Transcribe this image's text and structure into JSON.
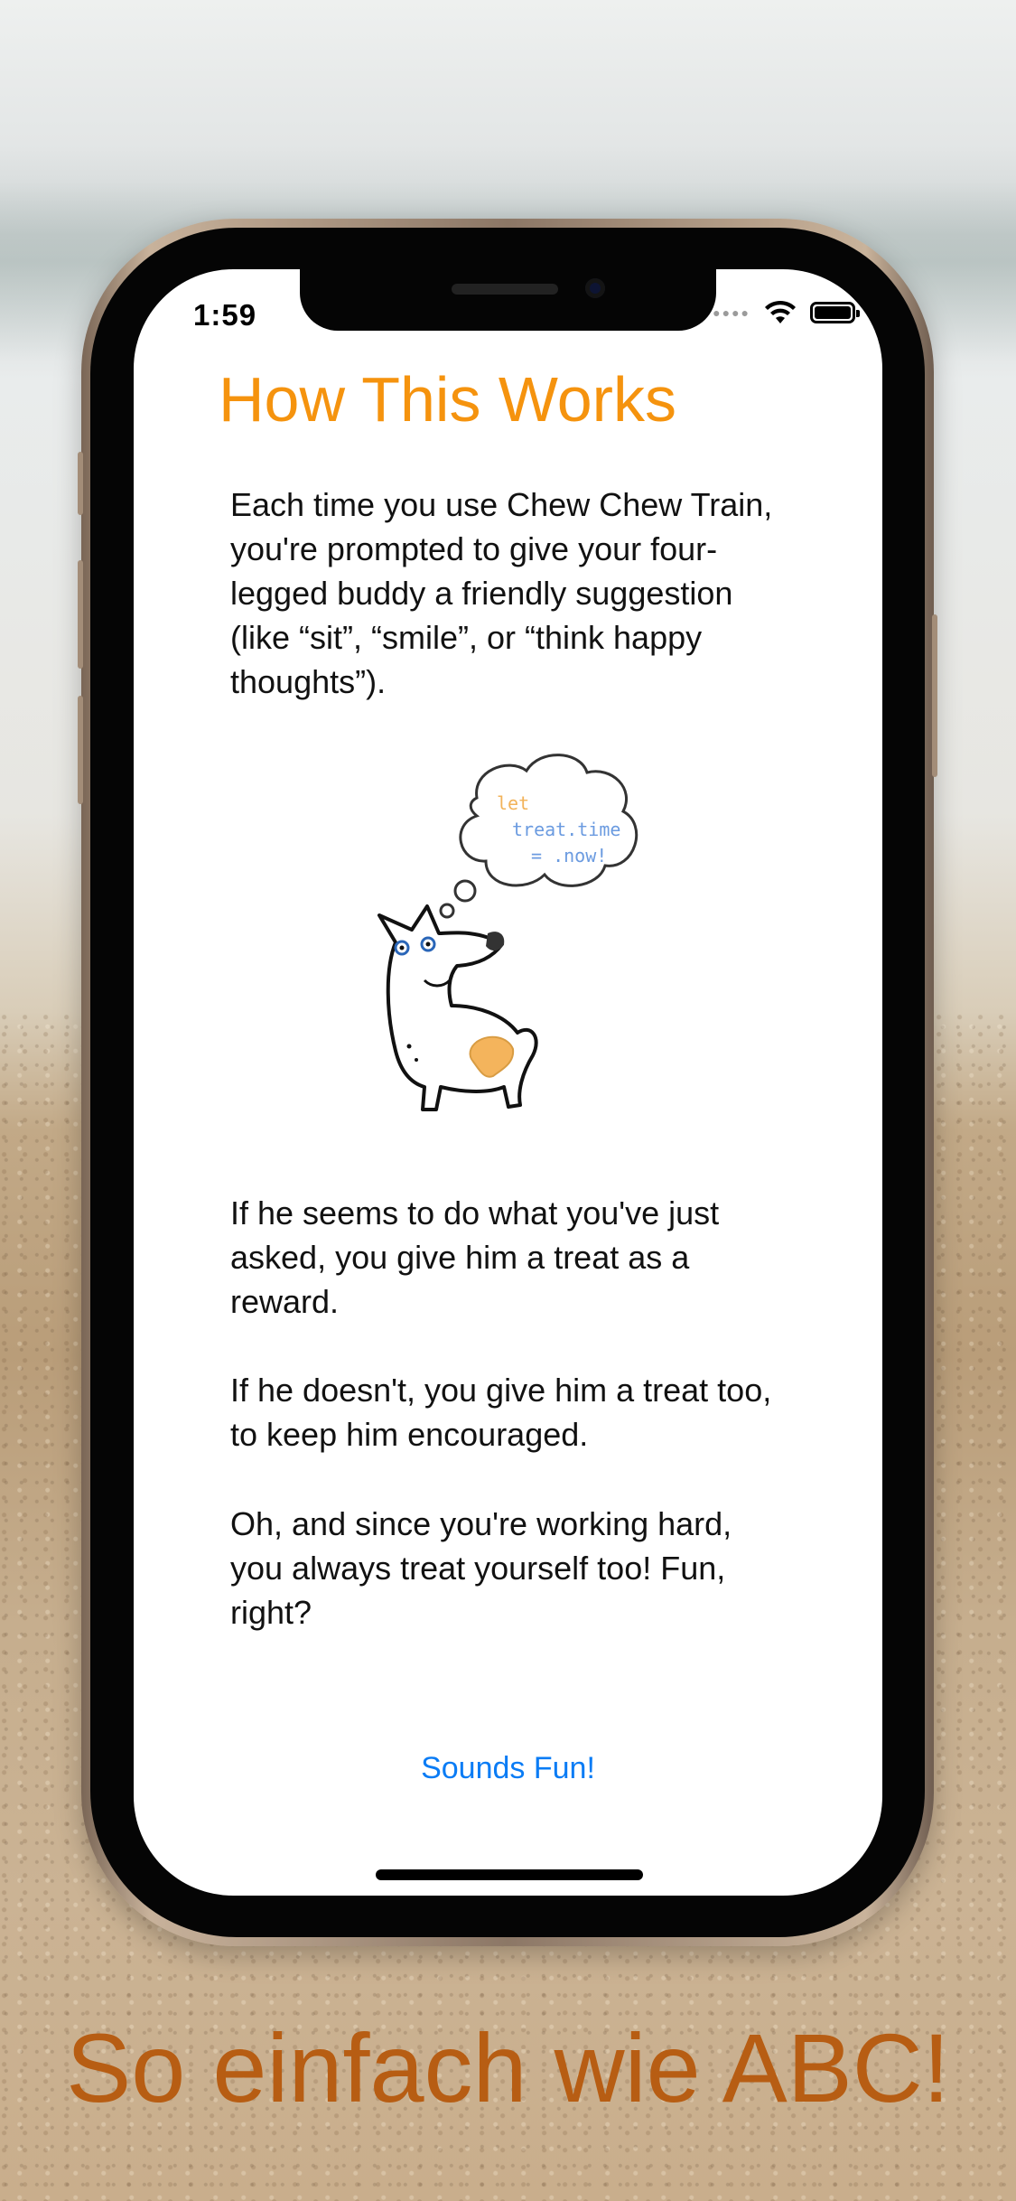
{
  "status_bar": {
    "time": "1:59",
    "signal_icon": "signal-dots-icon",
    "wifi_icon": "wifi-icon",
    "battery_icon": "battery-icon",
    "battery_level": 1.0
  },
  "screen": {
    "title": "How This Works",
    "paragraph_1": "Each time you use Chew Chew Train, you're prompted  to give your four-legged buddy a friendly suggestion (like “sit”, “smile”, or “think happy thoughts”).",
    "illustration": {
      "code_keyword": "let",
      "code_line_2": "treat.time",
      "code_line_3": "= .now!"
    },
    "paragraph_2": "If he seems to do what you've just asked, you give him a treat as a reward.",
    "paragraph_3": "If he doesn't, you give him a treat too, to keep him encouraged.",
    "paragraph_4": "Oh, and since you're working hard, you always treat yourself too! Fun, right?",
    "cta_label": "Sounds Fun!"
  },
  "caption": "So einfach wie ABC!",
  "colors": {
    "title": "#f5930e",
    "link": "#0a7cf5",
    "caption": "#b75d13"
  }
}
